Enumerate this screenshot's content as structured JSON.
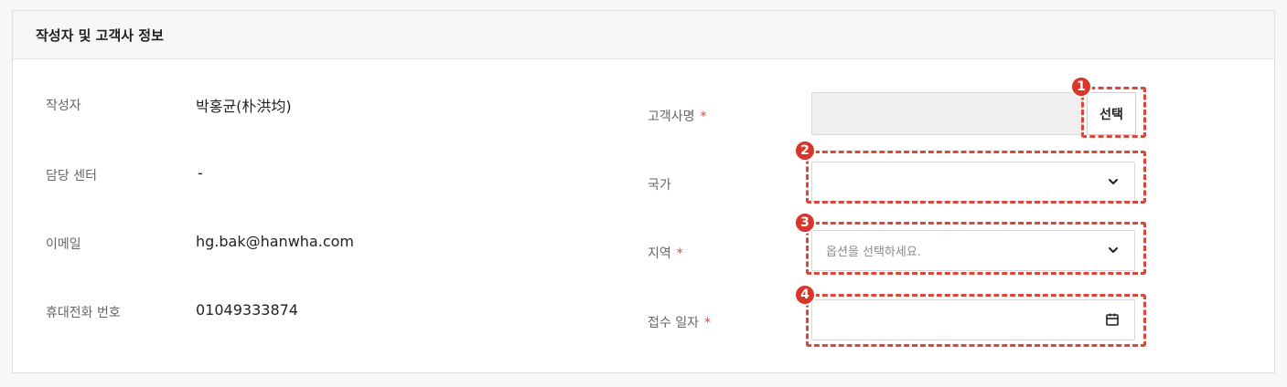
{
  "section": {
    "title": "작성자 및 고객사 정보"
  },
  "left": [
    {
      "label": "작성자",
      "value": "박홍균(朴洪均)"
    },
    {
      "label": "담당 센터",
      "value": "-"
    },
    {
      "label": "이메일",
      "value": "hg.bak@hanwha.com"
    },
    {
      "label": "휴대전화 번호",
      "value": "01049333874"
    }
  ],
  "right": {
    "customer": {
      "label": "고객사명",
      "required": "*",
      "value": "",
      "button": "선택"
    },
    "country": {
      "label": "국가",
      "value": ""
    },
    "region": {
      "label": "지역",
      "required": "*",
      "placeholder": "옵션을 선택하세요."
    },
    "date": {
      "label": "접수 일자",
      "required": "*",
      "value": ""
    }
  },
  "annotations": [
    "1",
    "2",
    "3",
    "4"
  ],
  "colors": {
    "annotation": "#d9362b",
    "required": "#e0493b"
  }
}
